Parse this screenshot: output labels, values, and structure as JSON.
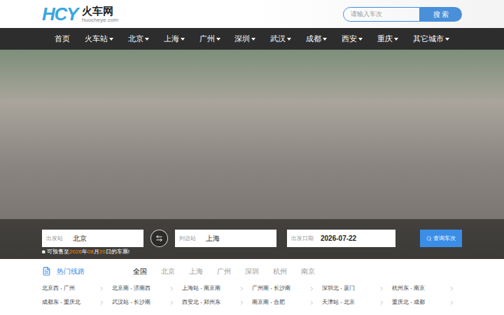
{
  "header": {
    "logo_mark": "HCY",
    "logo_title": "火车网",
    "logo_url": "huocheye.com",
    "search": {
      "placeholder": "请输入车次",
      "button": "搜 索"
    }
  },
  "nav": [
    {
      "label": "首页",
      "dropdown": false
    },
    {
      "label": "火车站",
      "dropdown": true
    },
    {
      "label": "北京",
      "dropdown": true
    },
    {
      "label": "上海",
      "dropdown": true
    },
    {
      "label": "广州",
      "dropdown": true
    },
    {
      "label": "深圳",
      "dropdown": true
    },
    {
      "label": "武汉",
      "dropdown": true
    },
    {
      "label": "成都",
      "dropdown": true
    },
    {
      "label": "西安",
      "dropdown": true
    },
    {
      "label": "重庆",
      "dropdown": true
    },
    {
      "label": "其它城市",
      "dropdown": true
    }
  ],
  "query": {
    "from": {
      "label": "出发站",
      "value": "北京"
    },
    "to": {
      "label": "到达站",
      "value": "上海"
    },
    "date": {
      "label": "出发日期",
      "value": "2026-07-22"
    },
    "button": "查询车次",
    "notice": [
      {
        "text": "■ 可预售至",
        "highlight": false
      },
      {
        "text": "2026",
        "highlight": true
      },
      {
        "text": "年",
        "highlight": false
      },
      {
        "text": "08",
        "highlight": true
      },
      {
        "text": "月",
        "highlight": false
      },
      {
        "text": "20",
        "highlight": true
      },
      {
        "text": "日的车票!",
        "highlight": false
      }
    ]
  },
  "routes": {
    "title": "热门线路",
    "tabs": [
      {
        "label": "全国",
        "selected": true
      },
      {
        "label": "北京",
        "selected": false
      },
      {
        "label": "上海",
        "selected": false
      },
      {
        "label": "广州",
        "selected": false
      },
      {
        "label": "深圳",
        "selected": false
      },
      {
        "label": "杭州",
        "selected": false
      },
      {
        "label": "南京",
        "selected": false
      }
    ],
    "items": [
      "北京西 - 广州",
      "北京南 - 济南西",
      "上海站 - 南京南",
      "广州南 - 长沙南",
      "深圳北 - 厦门",
      "杭州东 - 南京",
      "成都东 - 重庆北",
      "武汉站 - 长沙南",
      "西安北 - 郑州东",
      "南京南 - 合肥",
      "天津站 - 北京",
      "重庆北 - 成都"
    ]
  }
}
